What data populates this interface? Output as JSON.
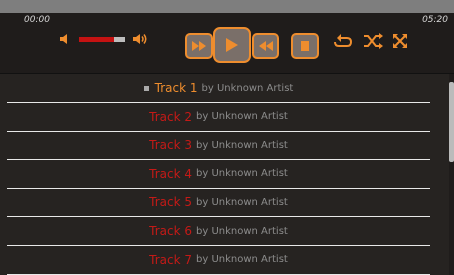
{
  "player": {
    "time_elapsed": "00:00",
    "time_total": "05:20",
    "volume_level": 0.75,
    "colors": {
      "accent": "#ee8d2e",
      "track": "#c41a17",
      "artist": "#8c8c8c"
    },
    "icons": [
      "volume-low-icon",
      "volume-high-icon",
      "fast-forward-icon",
      "play-icon",
      "rewind-icon",
      "stop-icon",
      "repeat-icon",
      "shuffle-icon",
      "expand-icon"
    ]
  },
  "playlist": {
    "active_index": 0,
    "tracks": [
      {
        "title": "Track 1",
        "artist": "by Unknown Artist"
      },
      {
        "title": "Track 2",
        "artist": "by Unknown Artist"
      },
      {
        "title": "Track 3",
        "artist": "by Unknown Artist"
      },
      {
        "title": "Track 4",
        "artist": "by Unknown Artist"
      },
      {
        "title": "Track 5",
        "artist": "by Unknown Artist"
      },
      {
        "title": "Track 6",
        "artist": "by Unknown Artist"
      },
      {
        "title": "Track 7",
        "artist": "by Unknown Artist"
      }
    ]
  }
}
